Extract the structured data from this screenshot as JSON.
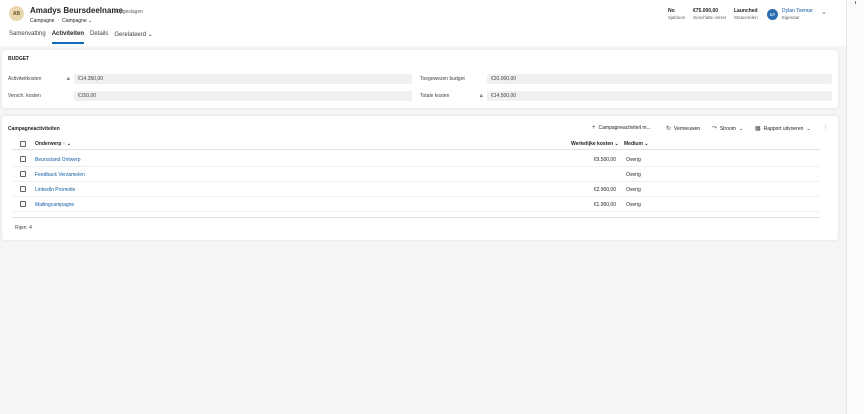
{
  "record": {
    "initials": "AB",
    "title": "Amadys Beursdeelname",
    "status": "- Opgeslagen",
    "entity": "Campagne",
    "form": "Campagne"
  },
  "header_fields": [
    {
      "value": "No",
      "label": "Sjabloon"
    },
    {
      "value": "€75.000,00",
      "label": "Geschatte omzet"
    },
    {
      "value": "Launched",
      "label": "Statusreden"
    }
  ],
  "owner": {
    "initials": "DT",
    "name": "Dylan Toemar",
    "label": "Eigenaar"
  },
  "tabs": [
    "Samenvatting",
    "Activiteiten",
    "Details",
    "Gerelateerd"
  ],
  "budget": {
    "title": "BUDGET",
    "fields": {
      "activity_costs": {
        "label": "Activiteitkosten",
        "value": "€14.350,00"
      },
      "misc_costs": {
        "label": "Versch. kosten",
        "value": "€150,00"
      },
      "allocated_budget": {
        "label": "Toegewezen budget",
        "value": "€20.000,00"
      },
      "total_costs": {
        "label": "Totale kosten",
        "value": "€14.500,00"
      }
    }
  },
  "grid": {
    "title": "Campagneactiviteiten",
    "commands": {
      "new": "Campagneactiviteit m...",
      "refresh": "Vernieuwen",
      "flow": "Stroom",
      "report": "Rapport uitvoeren"
    },
    "columns": {
      "subject": "Onderwerp",
      "subject_sort": "↑",
      "cost": "Werkelijke kosten",
      "medium": "Medium"
    },
    "rows": [
      {
        "subject": "Beursstand Ontwerp",
        "cost": "€9.500,00",
        "medium": "Overig"
      },
      {
        "subject": "Feedback Verzamelen",
        "cost": "",
        "medium": "Overig"
      },
      {
        "subject": "LinkedIn Promotie",
        "cost": "€2.900,00",
        "medium": "Overig"
      },
      {
        "subject": "Mailingcampagne",
        "cost": "€1.950,00",
        "medium": "Overig"
      }
    ],
    "row_count": "Rijen: 4"
  },
  "icons": [
    "lock-icon",
    "plus-icon",
    "refresh-icon",
    "flow-icon",
    "report-icon",
    "chevron-down-icon",
    "more-icon"
  ]
}
